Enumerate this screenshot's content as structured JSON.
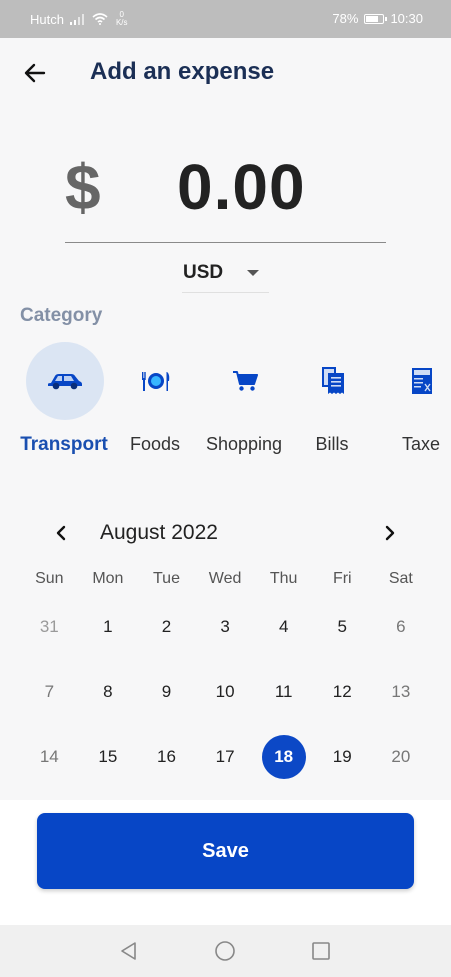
{
  "status_bar": {
    "carrier": "Hutch",
    "net_speed_value": "0",
    "net_speed_unit": "K/s",
    "battery": "78%",
    "battery_level": 0.78,
    "time": "10:30"
  },
  "header": {
    "back_icon": "arrow-left-icon",
    "title": "Add an expense"
  },
  "amount": {
    "symbol": "$",
    "value": "0.00"
  },
  "currency": {
    "selected": "USD"
  },
  "category": {
    "label": "Category",
    "items": [
      {
        "label": "Transport",
        "icon": "car-icon",
        "selected": true
      },
      {
        "label": "Foods",
        "icon": "plate-icon",
        "selected": false
      },
      {
        "label": "Shopping",
        "icon": "cart-icon",
        "selected": false
      },
      {
        "label": "Bills",
        "icon": "bill-icon",
        "selected": false
      },
      {
        "label": "Taxe",
        "icon": "tax-icon",
        "selected": false
      }
    ]
  },
  "calendar": {
    "month": "August 2022",
    "weekdays": [
      "Sun",
      "Mon",
      "Tue",
      "Wed",
      "Thu",
      "Fri",
      "Sat"
    ],
    "weeks": [
      [
        "31",
        "1",
        "2",
        "3",
        "4",
        "5",
        "6"
      ],
      [
        "7",
        "8",
        "9",
        "10",
        "11",
        "12",
        "13"
      ],
      [
        "14",
        "15",
        "16",
        "17",
        "18",
        "19",
        "20"
      ]
    ],
    "selected_day": "18"
  },
  "save_button": {
    "label": "Save"
  },
  "colors": {
    "accent": "#0746c6",
    "title": "#1b2f55",
    "category_label": "#8390a6",
    "selected_circle": "#dbe5f3"
  }
}
